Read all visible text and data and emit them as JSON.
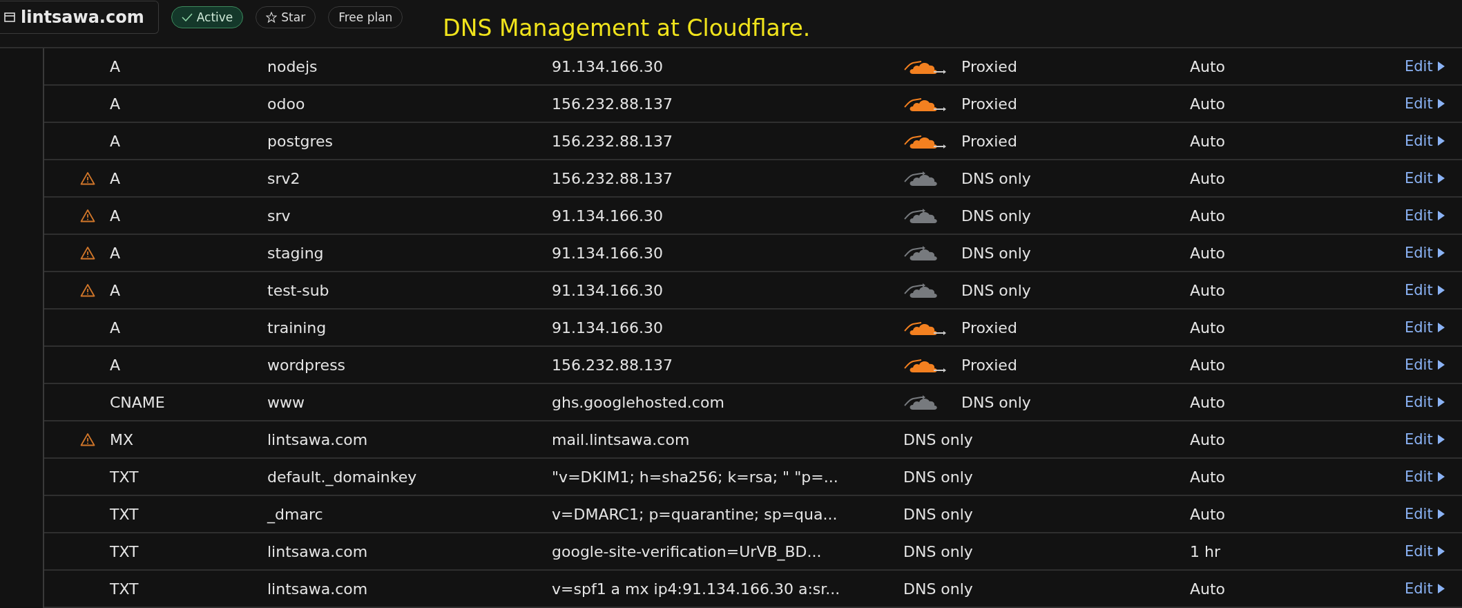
{
  "header": {
    "domain": "lintsawa.com",
    "badges": [
      {
        "label": "Active",
        "kind": "status"
      },
      {
        "label": "Star",
        "kind": "star"
      },
      {
        "label": "Free plan",
        "kind": "plan"
      }
    ],
    "caption": "DNS Management at Cloudflare."
  },
  "records": [
    {
      "warning": false,
      "type": "A",
      "name": "nodejs",
      "content": "91.134.166.30",
      "proxy": {
        "kind": "proxied",
        "label": "Proxied"
      },
      "ttl": "Auto",
      "action": "Edit"
    },
    {
      "warning": false,
      "type": "A",
      "name": "odoo",
      "content": "156.232.88.137",
      "proxy": {
        "kind": "proxied",
        "label": "Proxied"
      },
      "ttl": "Auto",
      "action": "Edit"
    },
    {
      "warning": false,
      "type": "A",
      "name": "postgres",
      "content": "156.232.88.137",
      "proxy": {
        "kind": "proxied",
        "label": "Proxied"
      },
      "ttl": "Auto",
      "action": "Edit"
    },
    {
      "warning": true,
      "type": "A",
      "name": "srv2",
      "content": "156.232.88.137",
      "proxy": {
        "kind": "dns-only",
        "label": "DNS only"
      },
      "ttl": "Auto",
      "action": "Edit"
    },
    {
      "warning": true,
      "type": "A",
      "name": "srv",
      "content": "91.134.166.30",
      "proxy": {
        "kind": "dns-only",
        "label": "DNS only"
      },
      "ttl": "Auto",
      "action": "Edit"
    },
    {
      "warning": true,
      "type": "A",
      "name": "staging",
      "content": "91.134.166.30",
      "proxy": {
        "kind": "dns-only",
        "label": "DNS only"
      },
      "ttl": "Auto",
      "action": "Edit"
    },
    {
      "warning": true,
      "type": "A",
      "name": "test-sub",
      "content": "91.134.166.30",
      "proxy": {
        "kind": "dns-only",
        "label": "DNS only"
      },
      "ttl": "Auto",
      "action": "Edit"
    },
    {
      "warning": false,
      "type": "A",
      "name": "training",
      "content": "91.134.166.30",
      "proxy": {
        "kind": "proxied",
        "label": "Proxied"
      },
      "ttl": "Auto",
      "action": "Edit"
    },
    {
      "warning": false,
      "type": "A",
      "name": "wordpress",
      "content": "156.232.88.137",
      "proxy": {
        "kind": "proxied",
        "label": "Proxied"
      },
      "ttl": "Auto",
      "action": "Edit"
    },
    {
      "warning": false,
      "type": "CNAME",
      "name": "www",
      "content": "ghs.googlehosted.com",
      "proxy": {
        "kind": "dns-only",
        "label": "DNS only"
      },
      "ttl": "Auto",
      "action": "Edit"
    },
    {
      "warning": true,
      "type": "MX",
      "name": "lintsawa.com",
      "content": "mail.lintsawa.com",
      "proxy": {
        "kind": "none",
        "label": "DNS only"
      },
      "ttl": "Auto",
      "action": "Edit"
    },
    {
      "warning": false,
      "type": "TXT",
      "name": "default._domainkey",
      "content": "\"v=DKIM1; h=sha256; k=rsa; \" \"p=...",
      "proxy": {
        "kind": "none",
        "label": "DNS only"
      },
      "ttl": "Auto",
      "action": "Edit"
    },
    {
      "warning": false,
      "type": "TXT",
      "name": "_dmarc",
      "content": "v=DMARC1; p=quarantine; sp=qua...",
      "proxy": {
        "kind": "none",
        "label": "DNS only"
      },
      "ttl": "Auto",
      "action": "Edit"
    },
    {
      "warning": false,
      "type": "TXT",
      "name": "lintsawa.com",
      "content": "google-site-verification=UrVB_BD...",
      "proxy": {
        "kind": "none",
        "label": "DNS only"
      },
      "ttl": "1 hr",
      "action": "Edit"
    },
    {
      "warning": false,
      "type": "TXT",
      "name": "lintsawa.com",
      "content": "v=spf1 a mx ip4:91.134.166.30 a:sr...",
      "proxy": {
        "kind": "none",
        "label": "DNS only"
      },
      "ttl": "Auto",
      "action": "Edit"
    }
  ]
}
